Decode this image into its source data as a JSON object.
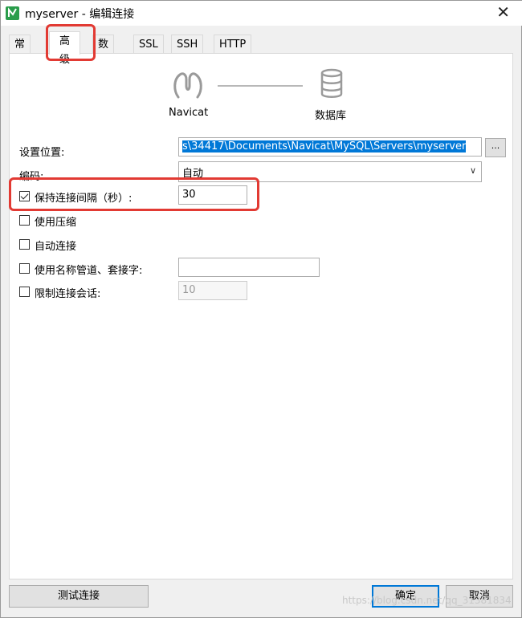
{
  "window": {
    "title": "myserver - 编辑连接",
    "close_icon": "close-icon"
  },
  "tabs": [
    {
      "label": "常规"
    },
    {
      "label": "高级"
    },
    {
      "label": "数据库"
    },
    {
      "label": "SSL"
    },
    {
      "label": "SSH"
    },
    {
      "label": "HTTP"
    }
  ],
  "active_tab": "高级",
  "diagram": {
    "left_label": "Navicat",
    "right_label": "数据库"
  },
  "form": {
    "settings_location": {
      "label": "设置位置:",
      "value": "s\\34417\\Documents\\Navicat\\MySQL\\Servers\\myserver",
      "browse_label": "..."
    },
    "encoding": {
      "label": "编码:",
      "value": "自动"
    },
    "keepalive": {
      "label": "保持连接间隔（秒）:",
      "checked": true,
      "value": "30"
    },
    "compression": {
      "label": "使用压缩",
      "checked": false
    },
    "auto_connect": {
      "label": "自动连接",
      "checked": false
    },
    "named_pipe": {
      "label": "使用名称管道、套接字:",
      "checked": false,
      "value": ""
    },
    "session_limit": {
      "label": "限制连接会话:",
      "checked": false,
      "value": "10"
    }
  },
  "buttons": {
    "test": "测试连接",
    "ok": "确定",
    "cancel": "取消"
  },
  "watermark": "https://blog.csdn.net/qq_31381834",
  "colors": {
    "highlight": "#e23a33",
    "selection": "#0078d7",
    "logo_green": "#2a9d4b"
  }
}
